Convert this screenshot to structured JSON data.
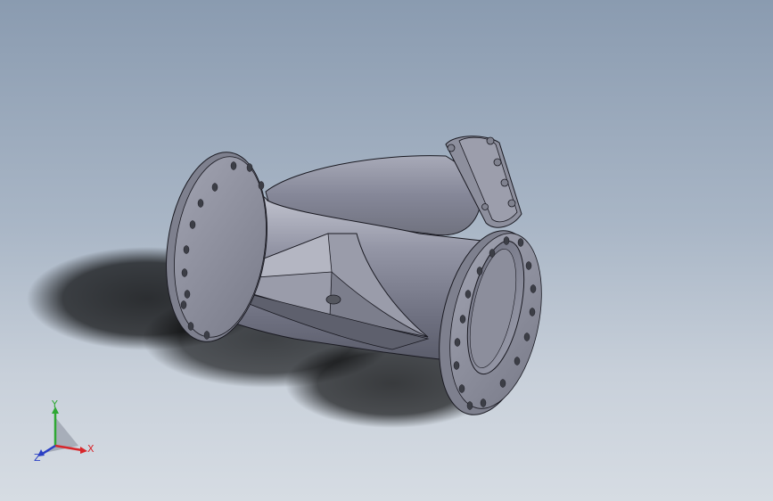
{
  "viewport": {
    "background_top": "#8a9bb0",
    "background_bottom": "#d6dce3",
    "model_color": "#8e909e",
    "edge_color": "#1a1a22"
  },
  "triad": {
    "x_label": "X",
    "y_label": "Y",
    "z_label": "Z",
    "x_color": "#d8262b",
    "y_color": "#2fa833",
    "z_color": "#2a3fc4"
  }
}
